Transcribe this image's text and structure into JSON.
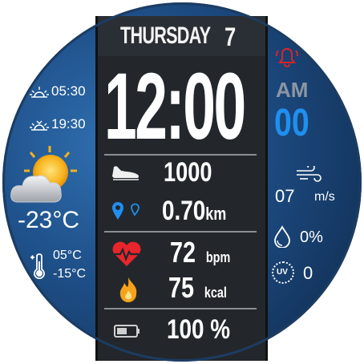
{
  "day_name": "THURSDAY",
  "day_number": "7",
  "time": "12:00",
  "am_pm": "AM",
  "seconds": "00",
  "sunrise": "05:30",
  "sunset": "19:30",
  "temperature": "-23°C",
  "temp_high": "05°C",
  "temp_low": "-15°C",
  "steps": "1000",
  "distance": "0.70",
  "distance_unit": "km",
  "heart_rate": "72",
  "heart_unit": "bpm",
  "calories": "75",
  "calories_unit": "kcal",
  "battery": "100 %",
  "wind_speed": "07",
  "wind_unit": "m/s",
  "humidity": "0%",
  "uv_index": "0",
  "uv_label": "UV",
  "colors": {
    "accent_blue": "#1f8ff0",
    "alarm_red": "#d8242b",
    "heart_red": "#e8252b",
    "flame_orange": "#f4a21c",
    "ampm_gray": "#8c96a2"
  },
  "icons": [
    "sunrise-icon",
    "sunset-icon",
    "partly-cloudy-icon",
    "thermometer-icon",
    "shoe-icon",
    "location-icon",
    "heart-icon",
    "flame-icon",
    "battery-icon",
    "alarm-icon",
    "wind-icon",
    "drop-icon",
    "uv-icon"
  ]
}
